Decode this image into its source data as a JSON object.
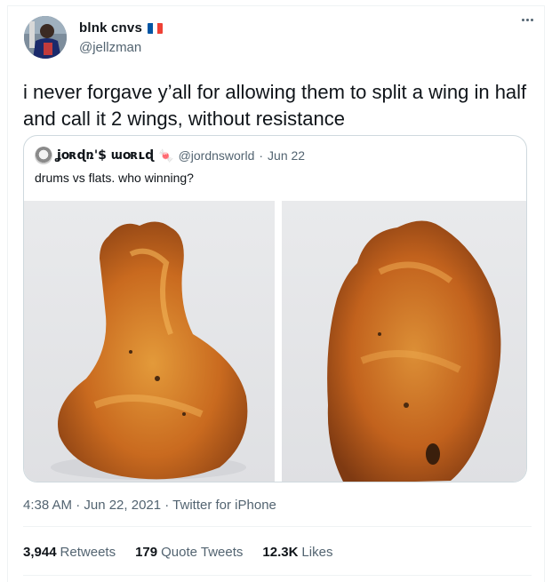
{
  "author": {
    "display_name": "blnk cnvs",
    "flag_icon": "france-flag-icon",
    "handle": "@jellzman"
  },
  "tweet": {
    "text": "i never forgave y’all for allowing them to split a wing in half and call it 2 wings, without resistance"
  },
  "quote": {
    "display_name": "ʝօʀɖռ'$ աօʀʟɖ",
    "emoji": "🍬",
    "handle": "@jordnsworld",
    "separator": "·",
    "date": "Jun 22",
    "text": "drums vs flats. who winning?",
    "images": [
      "drumette-photo",
      "flat-wing-photo"
    ]
  },
  "meta": {
    "time": "4:38 AM · Jun 22, 2021 · Twitter for iPhone"
  },
  "stats": {
    "retweets_count": "3,944",
    "retweets_label": "Retweets",
    "quotes_count": "179",
    "quotes_label": "Quote Tweets",
    "likes_count": "12.3K",
    "likes_label": "Likes"
  },
  "colors": {
    "text_primary": "#0f1419",
    "text_secondary": "#536471",
    "border": "#cfd9de",
    "flag_blue": "#0055a4",
    "flag_white": "#ffffff",
    "flag_red": "#ef4135"
  }
}
